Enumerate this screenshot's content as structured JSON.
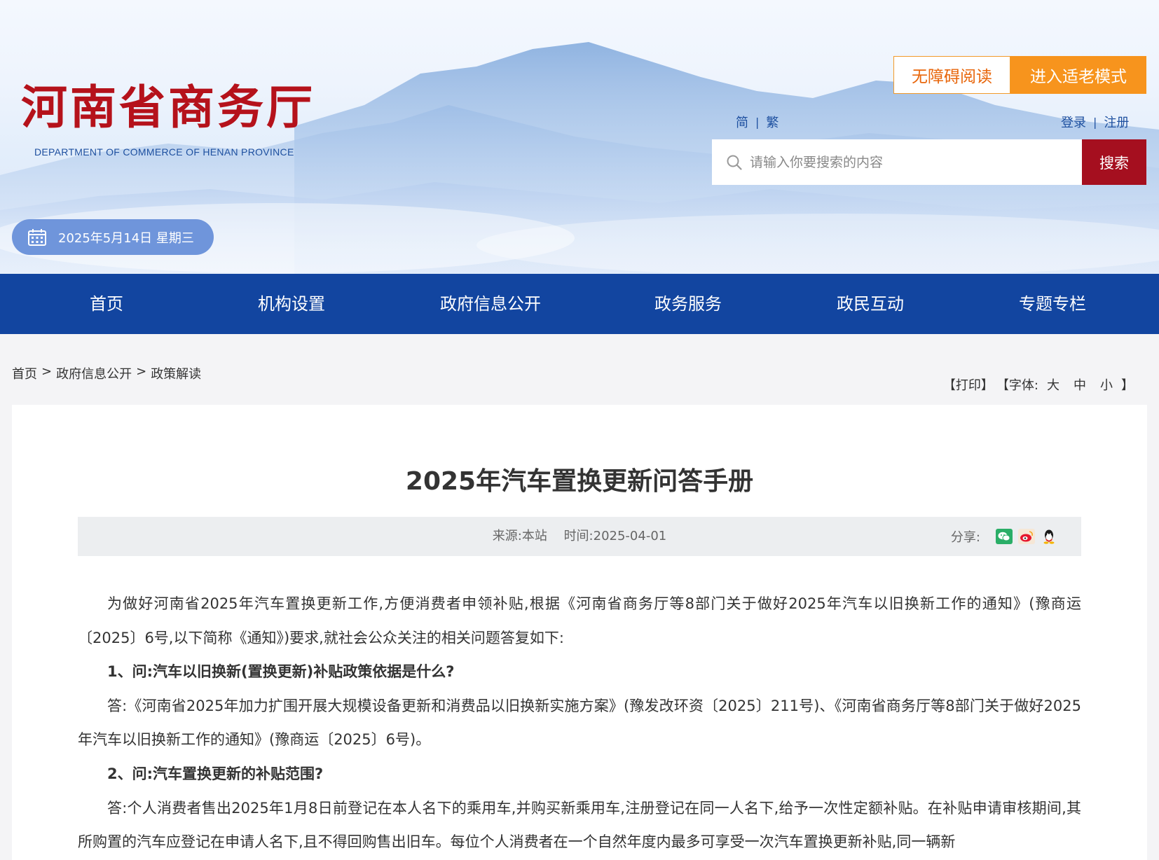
{
  "header": {
    "logo_cn": "河南省商务厅",
    "logo_en": "DEPARTMENT OF COMMERCE OF HENAN PROVINCE",
    "accessibility_label": "无障碍阅读",
    "elder_mode_label": "进入适老模式",
    "lang_simplified": "简",
    "lang_traditional": "繁",
    "login": "登录",
    "register": "注册",
    "search_placeholder": "请输入你要搜索的内容",
    "search_button": "搜索",
    "date": "2025年5月14日 星期三"
  },
  "nav": {
    "items": [
      {
        "label": "首页"
      },
      {
        "label": "机构设置"
      },
      {
        "label": "政府信息公开"
      },
      {
        "label": "政务服务"
      },
      {
        "label": "政民互动"
      },
      {
        "label": "专题专栏"
      }
    ]
  },
  "breadcrumb": {
    "home": "首页",
    "level1": "政府信息公开",
    "level2": "政策解读",
    "separator": ">"
  },
  "tools": {
    "print": "【打印】",
    "font_prefix": "【字体:",
    "large": "大",
    "medium": "中",
    "small": "小",
    "font_suffix": "】"
  },
  "article": {
    "title": "2025年汽车置换更新问答手册",
    "source": "来源:本站",
    "time": "时间:2025-04-01",
    "share_label": "分享:",
    "paragraphs": [
      {
        "type": "text",
        "text": "为做好河南省2025年汽车置换更新工作,方便消费者申领补贴,根据《河南省商务厅等8部门关于做好2025年汽车以旧换新工作的通知》(豫商运〔2025〕6号,以下简称《通知》)要求,就社会公众关注的相关问题答复如下:"
      },
      {
        "type": "q",
        "text": "1、问:汽车以旧换新(置换更新)补贴政策依据是什么?"
      },
      {
        "type": "text",
        "text": "答:《河南省2025年加力扩围开展大规模设备更新和消费品以旧换新实施方案》(豫发改环资〔2025〕211号)、《河南省商务厅等8部门关于做好2025年汽车以旧换新工作的通知》(豫商运〔2025〕6号)。"
      },
      {
        "type": "q",
        "text": "2、问:汽车置换更新的补贴范围?"
      },
      {
        "type": "text",
        "text": "答:个人消费者售出2025年1月8日前登记在本人名下的乘用车,并购买新乘用车,注册登记在同一人名下,给予一次性定额补贴。在补贴申请审核期间,其所购置的汽车应登记在申请人名下,且不得回购售出旧车。每位个人消费者在一个自然年度内最多可享受一次汽车置换更新补贴,同一辆新"
      }
    ]
  },
  "colors": {
    "brand_red": "#b5121b",
    "nav_blue": "#1245a0",
    "orange": "#f7941d",
    "search_red": "#a50f1f",
    "date_blue": "#6f95db"
  }
}
